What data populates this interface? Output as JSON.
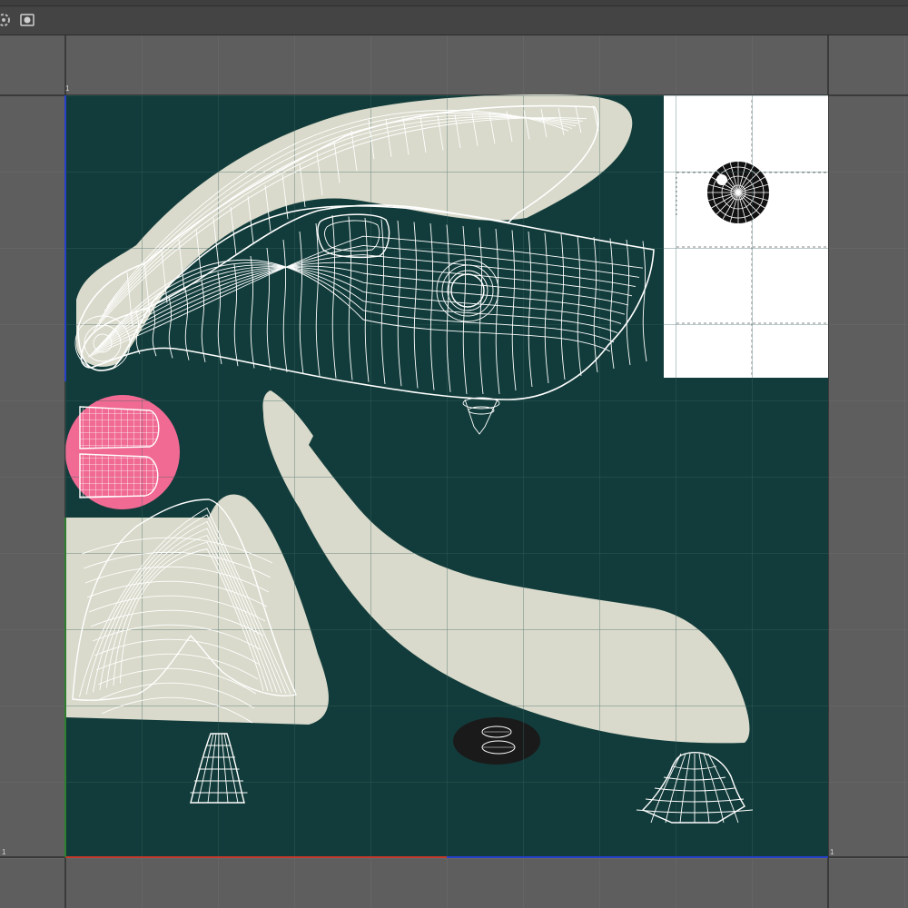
{
  "toolbar": {
    "tools": [
      {
        "name": "snap-toggle-icon"
      },
      {
        "name": "camera-icon"
      }
    ]
  },
  "viewport": {
    "uv_tile": {
      "background_color": "#123c3b",
      "corner_label_top_left": "1",
      "corner_label_bottom_left": "1",
      "corner_label_bottom_right": "1",
      "axis_u_color": "#c0392b",
      "axis_v_color": "#2f7d2f",
      "axis_w_color": "#2640c8"
    },
    "texture_regions": {
      "fill_color": "#d9dacb",
      "tongue_color": "#f06a93",
      "eye_panel_color": "#ffffff",
      "nostril_patch_color": "#1a1a1a"
    },
    "wire_color": "#ffffff"
  }
}
